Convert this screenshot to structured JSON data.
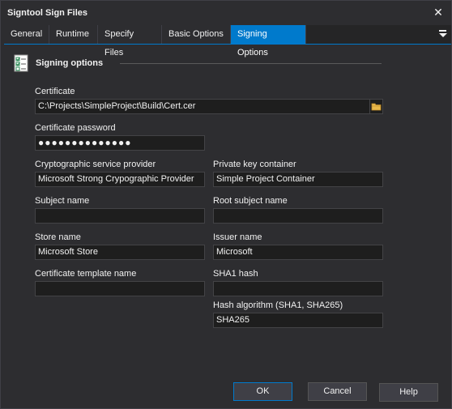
{
  "window": {
    "title": "Signtool Sign Files",
    "close_glyph": "✕"
  },
  "tabs": [
    {
      "label": "General"
    },
    {
      "label": "Runtime"
    },
    {
      "label": "Specify Files"
    },
    {
      "label": "Basic Options"
    },
    {
      "label": "Signing Options",
      "active": true
    }
  ],
  "section": {
    "title": "Signing options",
    "icon": "checklist-icon"
  },
  "fields": {
    "certificate": {
      "label": "Certificate",
      "value": "C:\\Projects\\SimpleProject\\Build\\Cert.cer"
    },
    "certificate_password": {
      "label": "Certificate password",
      "value": "●●●●●●●●●●●●●●"
    },
    "csp": {
      "label": "Cryptographic service provider",
      "value": "Microsoft Strong Crypographic Provider"
    },
    "private_key_container": {
      "label": "Private key container",
      "value": "Simple Project Container"
    },
    "subject_name": {
      "label": "Subject name",
      "value": ""
    },
    "root_subject_name": {
      "label": "Root subject name",
      "value": ""
    },
    "store_name": {
      "label": "Store name",
      "value": "Microsoft Store"
    },
    "issuer_name": {
      "label": "Issuer name",
      "value": "Microsoft"
    },
    "certificate_template_name": {
      "label": "Certificate template name",
      "value": ""
    },
    "sha1_hash": {
      "label": "SHA1 hash",
      "value": ""
    },
    "hash_algorithm": {
      "label": "Hash algorithm (SHA1, SHA265)",
      "value": "SHA265"
    }
  },
  "buttons": {
    "ok": "OK",
    "cancel": "Cancel",
    "help": "Help"
  },
  "colors": {
    "background": "#2d2d30",
    "accent": "#007acc",
    "input_bg": "#1e1e1e"
  }
}
